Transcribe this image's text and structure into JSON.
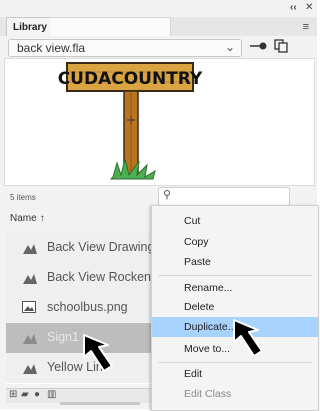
{
  "window": {
    "collapse_glyph": "‹‹",
    "close_glyph": "✕",
    "panel_menu_glyph": "≡"
  },
  "library": {
    "tab_label": "Library",
    "document": "back view.fla",
    "item_count": "5 items",
    "search_placeholder": "",
    "column_header": "Name",
    "sort_indicator": "↑",
    "preview": {
      "sign_text": "CUDACOUNTRY"
    },
    "items": [
      {
        "label": "Back View Drawing",
        "icon": "graphic-symbol-icon",
        "selected": false
      },
      {
        "label": "Back View Rocken",
        "icon": "graphic-symbol-icon",
        "selected": false
      },
      {
        "label": "schoolbus.png",
        "icon": "bitmap-icon",
        "selected": false
      },
      {
        "label": "Sign1",
        "icon": "graphic-symbol-icon",
        "selected": true
      },
      {
        "label": "Yellow Lin",
        "icon": "graphic-symbol-icon",
        "selected": false
      }
    ]
  },
  "context_menu": {
    "items": [
      {
        "label": "Cut",
        "highlighted": false,
        "disabled": false
      },
      {
        "label": "Copy",
        "highlighted": false,
        "disabled": false
      },
      {
        "label": "Paste",
        "highlighted": false,
        "disabled": false
      },
      {
        "label": "Rename...",
        "highlighted": false,
        "disabled": false
      },
      {
        "label": "Delete",
        "highlighted": false,
        "disabled": false
      },
      {
        "label": "Duplicate...",
        "highlighted": true,
        "disabled": false
      },
      {
        "label": "Move to...",
        "highlighted": false,
        "disabled": false
      },
      {
        "label": "Edit",
        "highlighted": false,
        "disabled": false
      },
      {
        "label": "Edit Class",
        "highlighted": false,
        "disabled": true
      }
    ]
  },
  "colors": {
    "highlight": "#a9d3ff",
    "selected_row": "#bdbdbd",
    "sign_board": "#d9a441",
    "sign_post": "#b8741e",
    "grass": "#4caf50"
  }
}
